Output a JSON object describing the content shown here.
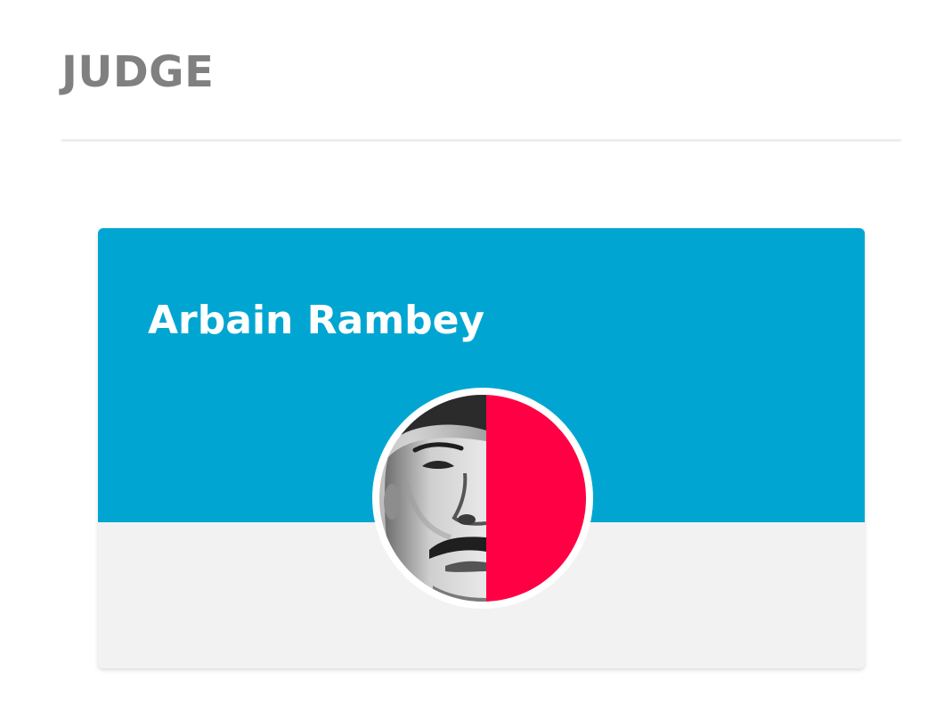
{
  "section": {
    "heading": "JUDGE"
  },
  "judge": {
    "name": "Arbain Rambey"
  },
  "colors": {
    "heading": "#808080",
    "banner": "#00a6d1",
    "card_body": "#f2f2f2",
    "avatar_accent": "#ff0044"
  },
  "avatar": {
    "description_icon": "portrait-photo"
  }
}
